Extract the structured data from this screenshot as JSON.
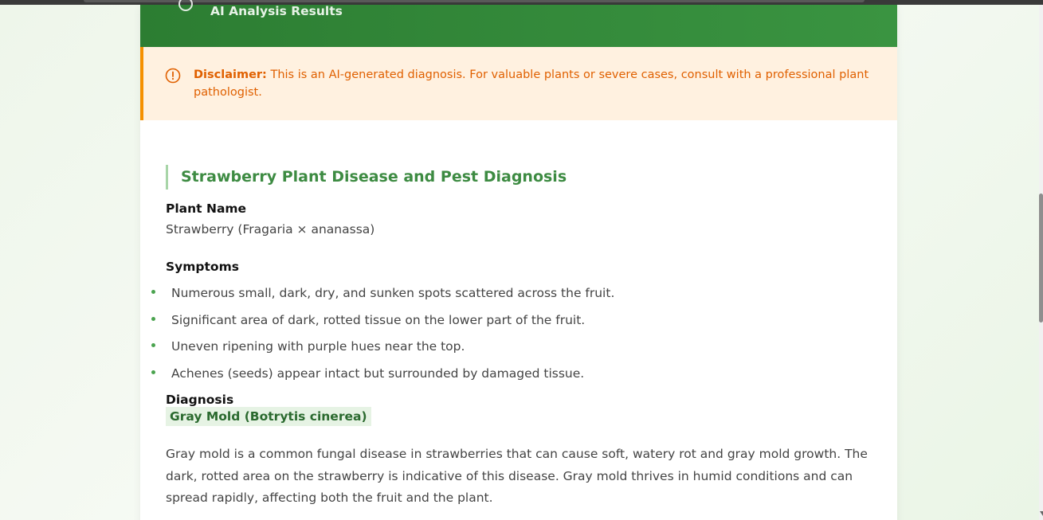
{
  "header": {
    "subtitle": "AI Analysis Results"
  },
  "disclaimer": {
    "label": "Disclaimer:",
    "text": " This is an AI-generated diagnosis. For valuable plants or severe cases, consult with a professional plant pathologist."
  },
  "report": {
    "title": "Strawberry Plant Disease and Pest Diagnosis",
    "plant_name_label": "Plant Name",
    "plant_name_value": "Strawberry (Fragaria × ananassa)",
    "symptoms_label": "Symptoms",
    "symptoms": [
      "Numerous small, dark, dry, and sunken spots scattered across the fruit.",
      "Significant area of dark, rotted tissue on the lower part of the fruit.",
      "Uneven ripening with purple hues near the top.",
      "Achenes (seeds) appear intact but surrounded by damaged tissue."
    ],
    "diagnosis_label": "Diagnosis",
    "diagnosis_value": "Gray Mold (Botrytis cinerea)",
    "description": "Gray mold is a common fungal disease in strawberries that can cause soft, watery rot and gray mold growth. The dark, rotted area on the strawberry is indicative of this disease. Gray mold thrives in humid conditions and can spread rapidly, affecting both the fruit and the plant."
  },
  "colors": {
    "header_green": "#2c7d32",
    "accent_green": "#3d8b42",
    "warning_orange": "#e06000",
    "warning_bg": "#fff1e0"
  }
}
